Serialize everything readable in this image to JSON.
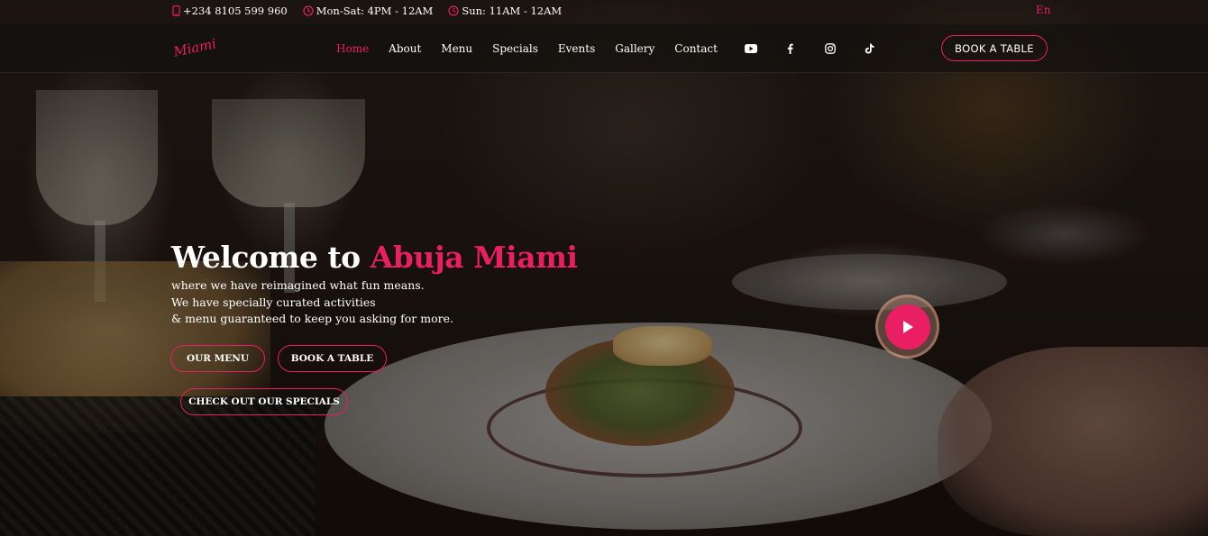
{
  "topbar": {
    "phone": "+234 8105 599 960",
    "weekday_hours": "Mon-Sat: 4PM - 12AM",
    "sunday_hours": "Sun: 11AM - 12AM",
    "language": "En"
  },
  "navbar": {
    "logo_text": "Miami",
    "links": [
      {
        "label": "Home",
        "active": true
      },
      {
        "label": "About"
      },
      {
        "label": "Menu"
      },
      {
        "label": "Specials"
      },
      {
        "label": "Events"
      },
      {
        "label": "Gallery"
      },
      {
        "label": "Contact"
      }
    ],
    "social": [
      "youtube-icon",
      "facebook-icon",
      "instagram-icon",
      "tiktok-icon"
    ],
    "book_button": "BOOK A TABLE"
  },
  "hero": {
    "title_prefix": "Welcome to",
    "title_brand": "Abuja Miami",
    "lines": [
      "where we have reimagined what fun means.",
      "We have specially curated activities",
      "& menu guaranteed to keep you asking for more."
    ],
    "buttons": {
      "menu": "OUR MENU",
      "table": "BOOK A TABLE",
      "specials": "CHECK OUT OUR SPECIALS"
    }
  },
  "colors": {
    "accent": "#e91e63",
    "text": "#ffffff",
    "navbar_bg": "#141010"
  }
}
